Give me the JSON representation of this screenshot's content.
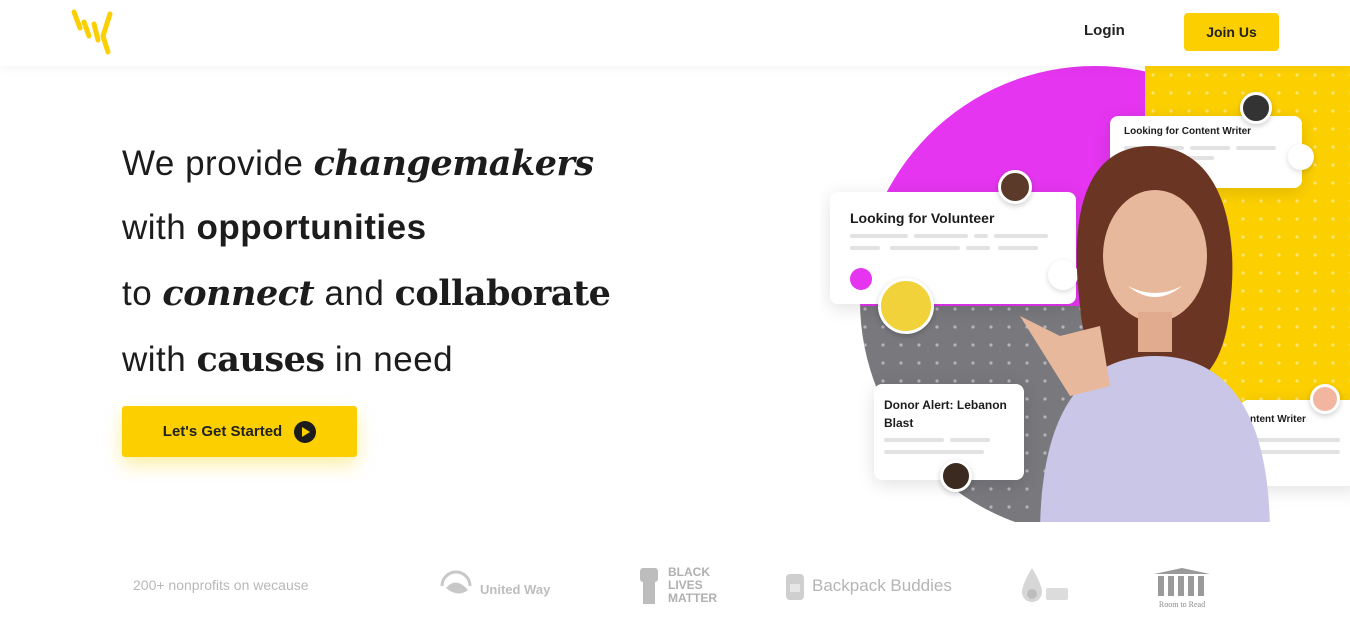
{
  "header": {
    "login_label": "Login",
    "join_label": "Join Us",
    "logo_icon": "wecause-logo-icon",
    "accent_color": "#fcd000"
  },
  "hero": {
    "line1_plain": "We provide ",
    "line1_emph": "changemakers",
    "line2_plain": "with ",
    "line2_emph": "opportunities",
    "line3_plain1": "to ",
    "line3_emph1": "connect",
    "line3_plain2": " and ",
    "line3_emph2": "collaborate",
    "line4_plain1": "with ",
    "line4_emph": "causes",
    "line4_plain2": " in need",
    "cta_label": "Let's Get Started",
    "cta_icon": "play-icon"
  },
  "illustration": {
    "card_content_writer": "Looking for Content Writer",
    "card_volunteer": "Looking for Volunteer",
    "card_donor": "Donor Alert: Lebanon Blast",
    "card_partial_writer": "ntent Writer",
    "colors": {
      "magenta": "#e535f0",
      "yellow": "#fcd000",
      "gray": "#78787d"
    }
  },
  "partners": {
    "label": "200+ nonprofits on wecause",
    "logos": [
      {
        "name": "United Way",
        "icon": "united-way-icon"
      },
      {
        "name": "BLACK LIVES MATTER",
        "icon": "fist-icon"
      },
      {
        "name": "Backpack Buddies",
        "icon": "backpack-icon"
      },
      {
        "name": "",
        "icon": "water-drop-icon"
      },
      {
        "name": "Room to Read",
        "icon": "books-icon"
      }
    ]
  }
}
